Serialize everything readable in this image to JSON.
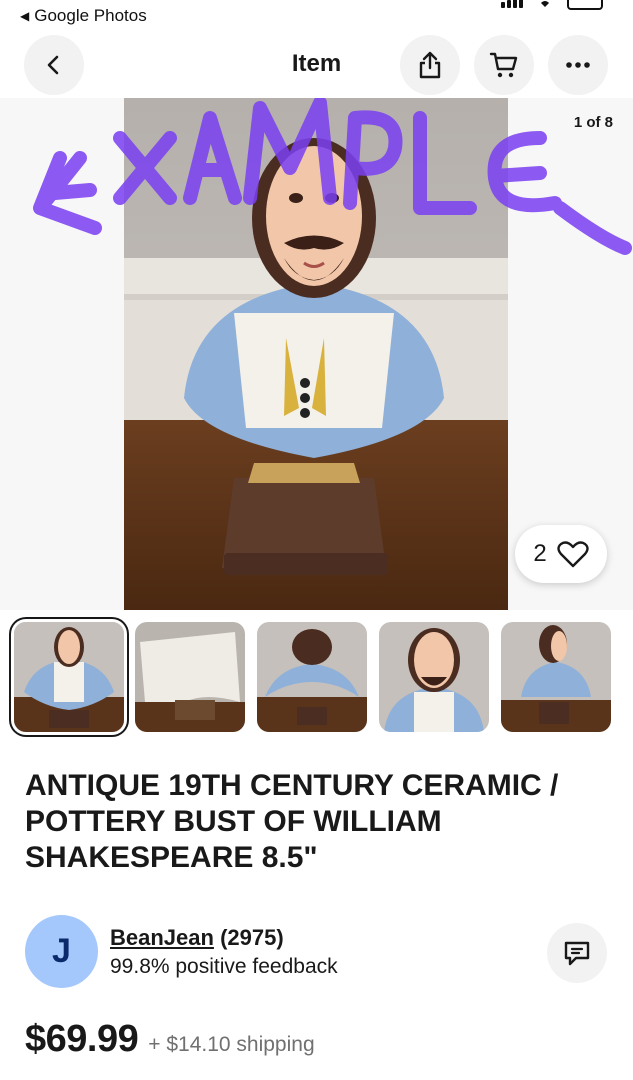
{
  "status_bar": {
    "back_app_label": "Google Photos",
    "back_app_icon": "back-triangle-icon"
  },
  "nav": {
    "title": "Item",
    "back_icon": "chevron-left-icon",
    "share_icon": "share-icon",
    "cart_icon": "cart-icon",
    "more_icon": "more-horizontal-icon"
  },
  "gallery": {
    "counter": "1 of 8",
    "watermark_text": "EXAMPLE",
    "watermark_color": "#7a3ff2",
    "like_count": "2",
    "like_icon": "heart-outline-icon"
  },
  "thumbnails": [
    {
      "name": "front bust",
      "selected": true
    },
    {
      "name": "base underside",
      "selected": false
    },
    {
      "name": "back view",
      "selected": false
    },
    {
      "name": "face close-up",
      "selected": false
    },
    {
      "name": "side profile",
      "selected": false
    }
  ],
  "listing": {
    "title": "ANTIQUE 19TH CENTURY CERAMIC / POTTERY BUST OF WILLIAM SHAKESPEARE 8.5\"",
    "price": "$69.99",
    "shipping": "+ $14.10 shipping"
  },
  "seller": {
    "avatar_letter": "J",
    "avatar_color": "#a4c8fb",
    "name": "BeanJean",
    "score": "(2975)",
    "feedback": "99.8% positive feedback",
    "message_icon": "chat-icon"
  }
}
